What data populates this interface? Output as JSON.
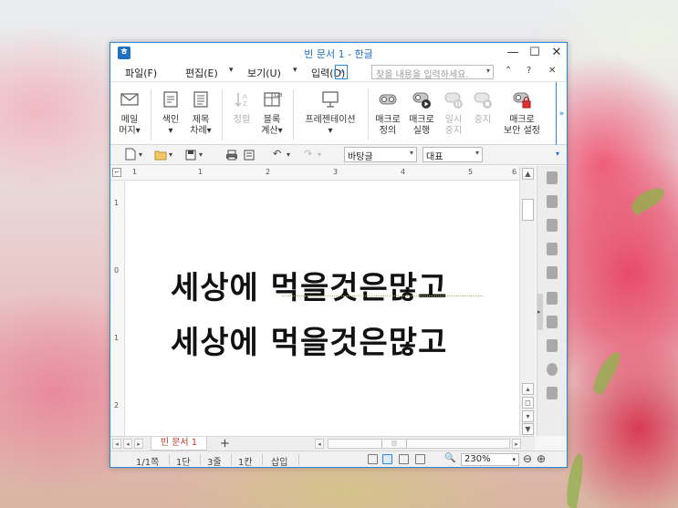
{
  "window": {
    "title": "빈 문서 1 - 한글",
    "controls": {
      "minimize": "—",
      "maximize": "☐",
      "close": "✕"
    }
  },
  "menubar": {
    "items": [
      "파일(F)",
      "편집(E)",
      "보기(U)",
      "입력(D)"
    ],
    "more": "»",
    "search_placeholder": "찾을 내용을 입력하세요.",
    "right_icons": [
      "⌃",
      "?",
      "✕"
    ]
  },
  "ribbon": {
    "buttons": [
      {
        "label1": "메일",
        "label2": "머지▾",
        "icon": "mail-icon",
        "enabled": true
      },
      {
        "label1": "색인",
        "label2": "▾",
        "icon": "index-icon",
        "enabled": true
      },
      {
        "label1": "제목",
        "label2": "차례▾",
        "icon": "toc-icon",
        "enabled": true
      },
      {
        "label1": "정렬",
        "label2": "",
        "icon": "sort-icon",
        "enabled": false
      },
      {
        "label1": "블록",
        "label2": "계산▾",
        "icon": "block-calc-icon",
        "enabled": true
      },
      {
        "label1": "프레젠테이션",
        "label2": "▾",
        "icon": "presentation-icon",
        "enabled": true
      },
      {
        "label1": "매크로",
        "label2": "정의",
        "icon": "macro-define-icon",
        "enabled": true
      },
      {
        "label1": "매크로",
        "label2": "실행",
        "icon": "macro-run-icon",
        "enabled": true
      },
      {
        "label1": "일시",
        "label2": "중지",
        "icon": "macro-pause-icon",
        "enabled": false
      },
      {
        "label1": "중지",
        "label2": "",
        "icon": "macro-stop-icon",
        "enabled": false
      },
      {
        "label1": "매크로",
        "label2": "보안 설정",
        "icon": "macro-security-icon",
        "enabled": true
      }
    ],
    "collapse": "»"
  },
  "toolbar": {
    "style_value": "바탕글",
    "font_value": "대표"
  },
  "ruler": {
    "h_marks": [
      "1",
      "1",
      "2",
      "3",
      "4",
      "5",
      "6"
    ],
    "v_marks": [
      "1",
      "0",
      "1",
      "2"
    ]
  },
  "document": {
    "lines": [
      "세상에 먹을것은많고",
      "세상에 먹을것은많고"
    ]
  },
  "tabs": {
    "current": "빈 문서 1",
    "add": "+"
  },
  "statusbar": {
    "page": "1/1쪽",
    "section": "1단",
    "line": "3줄",
    "column": "1칸",
    "mode": "삽입",
    "zoom": "230%"
  }
}
